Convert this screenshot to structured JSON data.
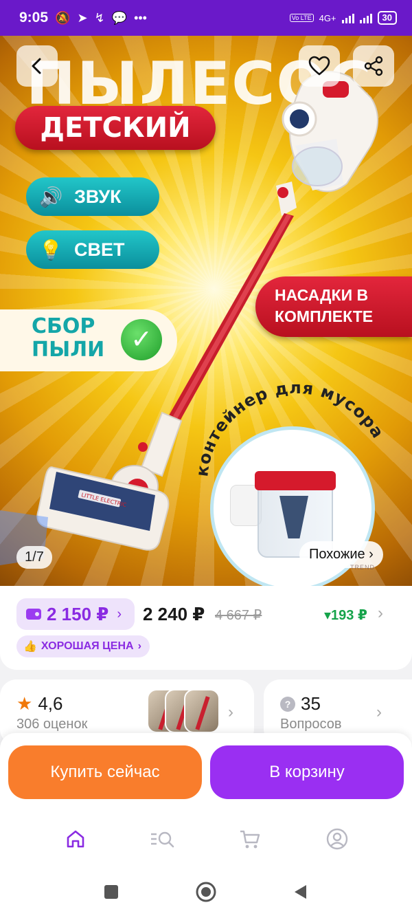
{
  "status_bar": {
    "time": "9:05",
    "dots": "•••",
    "network": "4G+",
    "volte": "Vo LTE",
    "battery": "30"
  },
  "hero": {
    "title_text": "ПЫЛЕСОС",
    "badge_kids": "ДЕТСКИЙ",
    "feature_sound": "ЗВУК",
    "feature_light": "СВЕТ",
    "feature_dust_line1": "СБОР",
    "feature_dust_line2": "ПЫЛИ",
    "attachments_line1": "НАСАДКИ В",
    "attachments_line2": "КОМПЛЕКТЕ",
    "container_caption": "контейнер для мусора",
    "brush_brand": "LITTLE ELECTRIC",
    "watermark": "TREND",
    "counter_current": "1",
    "counter_sep": "/",
    "counter_total": "7",
    "similar_label": "Похожие ›",
    "colors": {
      "teal": "#14a6a8",
      "red": "#d51a2c",
      "yellow": "#f5c614"
    }
  },
  "price": {
    "wallet_price": "2 150 ₽",
    "main_price": "2 240 ₽",
    "old_price": "4 667 ₽",
    "discount": "▾193 ₽",
    "good_price_label": "ХОРОШАЯ ЦЕНА",
    "accent_color": "#8a2be2",
    "discount_color": "#15a34a"
  },
  "reviews": {
    "rating": "4,6",
    "count_label": "306 оценок"
  },
  "questions": {
    "count": "35",
    "label": "Вопросов"
  },
  "actions": {
    "buy_now": "Купить сейчас",
    "add_to_cart": "В корзину",
    "buy_color": "#f97d2c",
    "cart_color": "#9a2ff2"
  },
  "nav": {
    "items": [
      "home-icon",
      "catalog-search-icon",
      "cart-icon",
      "profile-icon"
    ],
    "active": "home-icon"
  }
}
